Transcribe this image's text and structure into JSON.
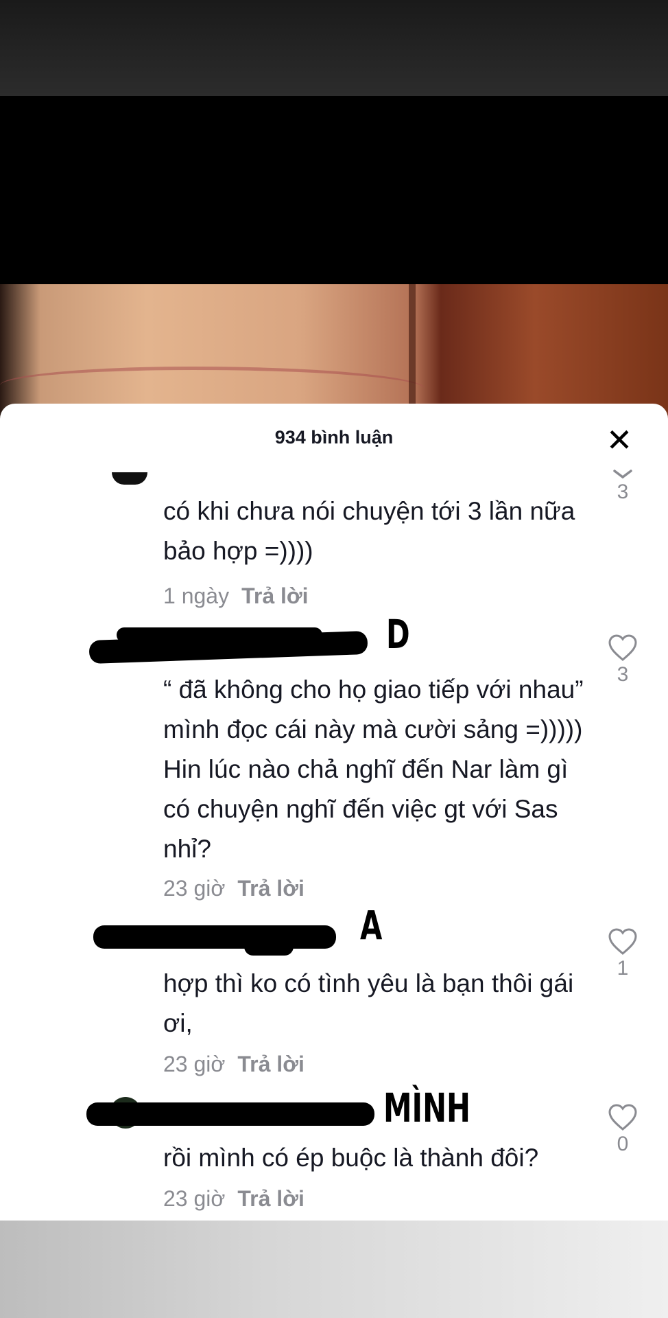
{
  "header": {
    "comment_count_title": "934 bình luận",
    "close_icon": "close-icon"
  },
  "comments": [
    {
      "text": "có khi chưa nói chuyện tới 3 lần nữa bảo hợp =))))",
      "time": "1 ngày",
      "reply_label": "Trả lời",
      "like_count": "3"
    },
    {
      "marker": "D",
      "text": "“ đã không cho họ giao tiếp với nhau” mình đọc cái này mà cười sảng =))))) Hin lúc nào chả nghĩ đến Nar làm gì có chuyện nghĩ đến việc gt với Sas nhỉ?",
      "time": "23 giờ",
      "reply_label": "Trả lời",
      "like_count": "3"
    },
    {
      "marker": "A",
      "text": "hợp thì ko có tình yêu là bạn thôi gái ơi,",
      "time": "23 giờ",
      "reply_label": "Trả lời",
      "like_count": "1"
    },
    {
      "marker": "MÌNH",
      "text": "rồi mình có ép buộc là thành đôi?",
      "time": "23 giờ",
      "reply_label": "Trả lời",
      "like_count": "0"
    }
  ],
  "colors": {
    "text_primary": "#161823",
    "text_secondary": "#8a8b91",
    "sheet_bg": "#ffffff"
  }
}
